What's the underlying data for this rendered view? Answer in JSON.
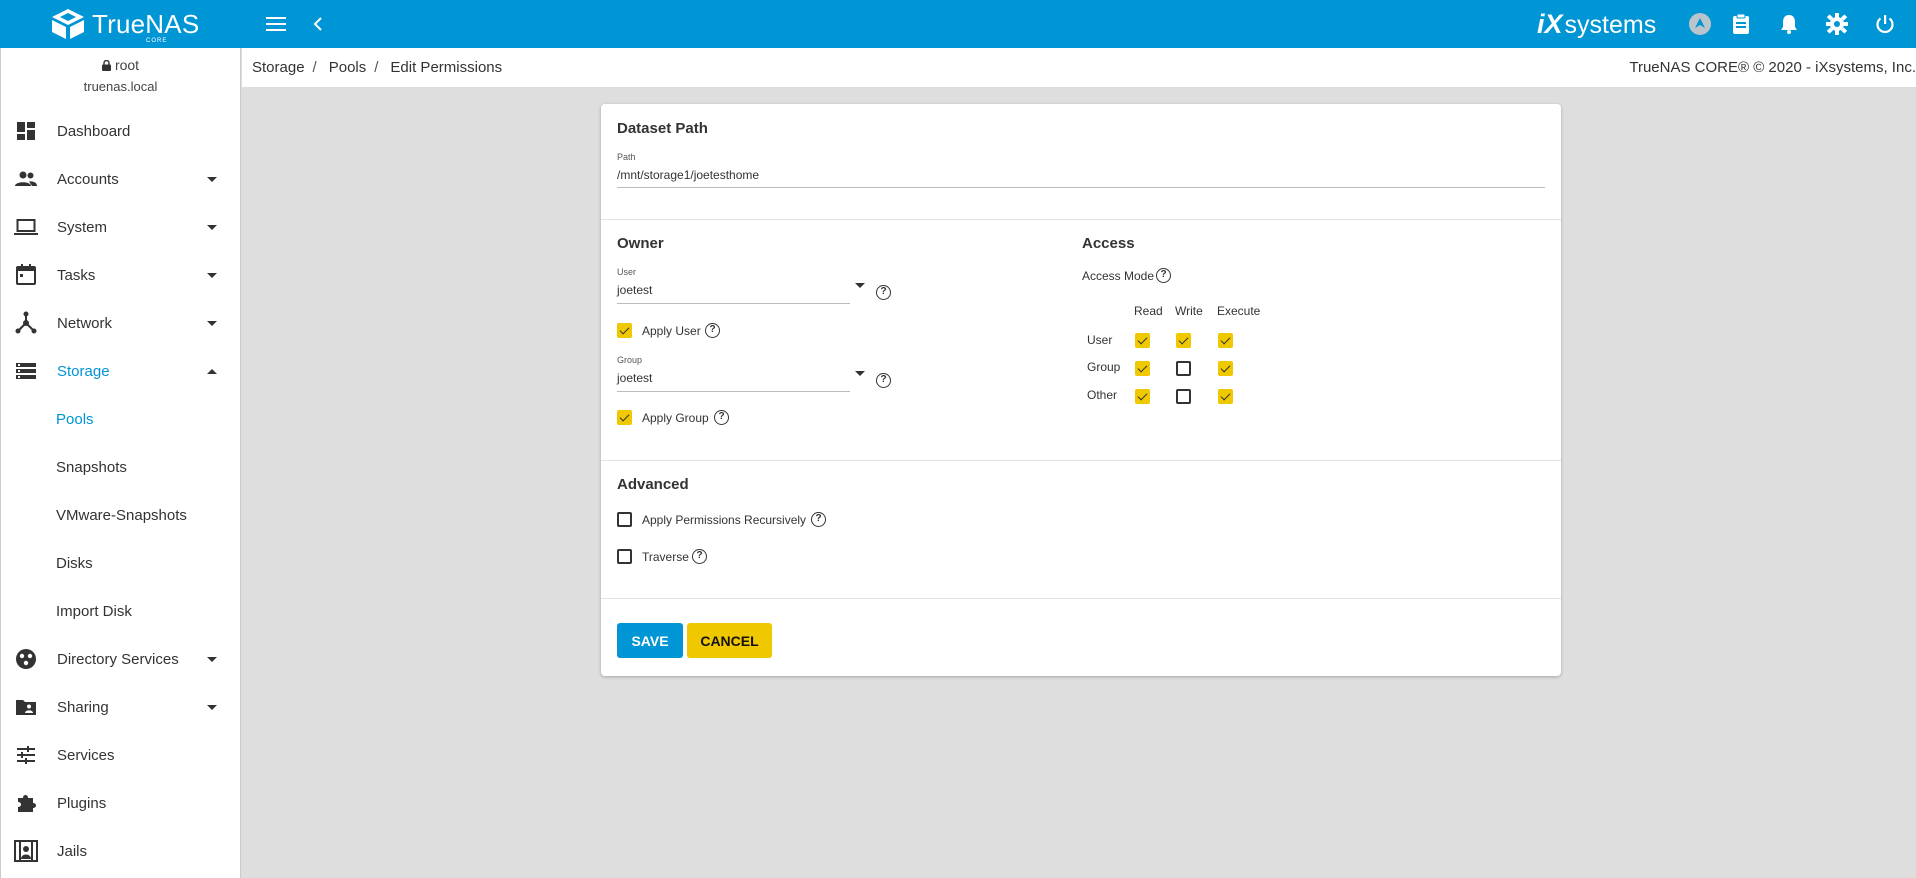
{
  "app": {
    "logo_name": "TrueNAS",
    "logo_sub": "CORE",
    "vendor_logo_ix": "iX",
    "vendor_logo_systems": "systems",
    "colors": {
      "primary": "#0095d5",
      "accent": "#f0c800"
    }
  },
  "topbar": {
    "icons": [
      "menu-icon",
      "back-chevron-icon",
      "truecommand-icon",
      "clipboard-icon",
      "bell-icon",
      "gear-icon",
      "power-icon"
    ]
  },
  "user": {
    "name": "root",
    "host": "truenas.local"
  },
  "sidebar": {
    "items": [
      {
        "label": "Dashboard",
        "icon": "dashboard-icon"
      },
      {
        "label": "Accounts",
        "icon": "accounts-icon"
      },
      {
        "label": "System",
        "icon": "laptop-icon"
      },
      {
        "label": "Tasks",
        "icon": "calendar-icon"
      },
      {
        "label": "Network",
        "icon": "network-icon"
      },
      {
        "label": "Storage",
        "icon": "storage-icon"
      },
      {
        "label": "Directory Services",
        "icon": "directory-icon"
      },
      {
        "label": "Sharing",
        "icon": "sharing-folder-icon"
      },
      {
        "label": "Services",
        "icon": "sliders-icon"
      },
      {
        "label": "Plugins",
        "icon": "puzzle-icon"
      },
      {
        "label": "Jails",
        "icon": "jail-icon"
      }
    ],
    "storage_sub": [
      "Pools",
      "Snapshots",
      "VMware-Snapshots",
      "Disks",
      "Import Disk"
    ]
  },
  "breadcrumb": [
    "Storage",
    "Pools",
    "Edit Permissions"
  ],
  "copyright": "TrueNAS CORE® © 2020 - iXsystems, Inc.",
  "form": {
    "dataset": {
      "title": "Dataset Path",
      "path_label": "Path",
      "path_value": "/mnt/storage1/joetesthome"
    },
    "owner": {
      "title": "Owner",
      "user_label": "User",
      "user_value": "joetest",
      "apply_user_label": "Apply User",
      "apply_user_checked": true,
      "group_label": "Group",
      "group_value": "joetest",
      "apply_group_label": "Apply Group",
      "apply_group_checked": true
    },
    "access": {
      "title": "Access",
      "mode_label": "Access Mode",
      "columns": [
        "Read",
        "Write",
        "Execute"
      ],
      "rows": [
        {
          "label": "User",
          "values": [
            true,
            true,
            true
          ]
        },
        {
          "label": "Group",
          "values": [
            true,
            false,
            true
          ]
        },
        {
          "label": "Other",
          "values": [
            true,
            false,
            true
          ]
        }
      ]
    },
    "advanced": {
      "title": "Advanced",
      "recursive_label": "Apply Permissions Recursively",
      "recursive_checked": false,
      "traverse_label": "Traverse",
      "traverse_checked": false
    },
    "buttons": {
      "save": "SAVE",
      "cancel": "CANCEL"
    }
  }
}
